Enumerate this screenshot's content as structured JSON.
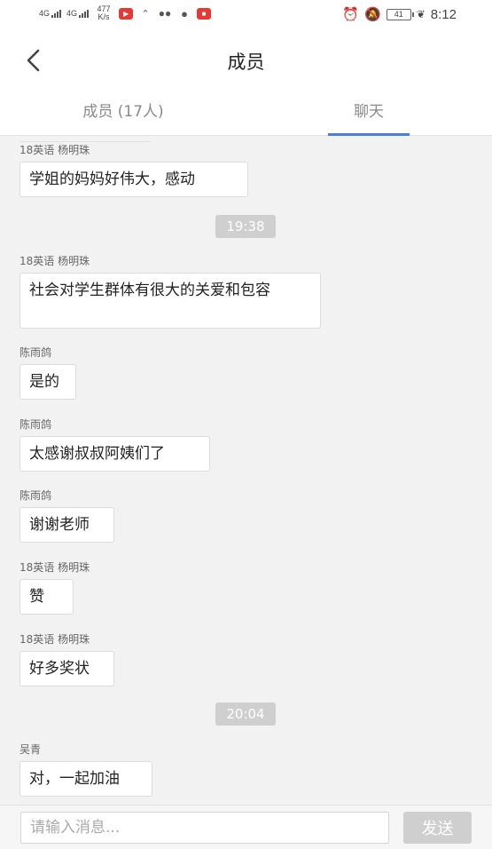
{
  "status_bar": {
    "signal1": "4G",
    "signal2": "4G",
    "speed_value": "477",
    "speed_unit": "K/s",
    "battery": "41",
    "time": "8:12",
    "icons": [
      "alarm-icon",
      "mute-icon",
      "battery-icon",
      "leaf-icon"
    ]
  },
  "header": {
    "title": "成员",
    "back_icon": "chevron-left-icon"
  },
  "tabs": [
    {
      "label": "成员 (17人)",
      "active": false
    },
    {
      "label": "聊天",
      "active": true
    }
  ],
  "accent_color": "#4c7fd6",
  "messages": [
    {
      "sender": "18英语 杨明珠",
      "text": "学姐的妈妈好伟大，感动"
    },
    {
      "time": "19:38"
    },
    {
      "sender": "18英语 杨明珠",
      "text": "社会对学生群体有很大的关爱和包容"
    },
    {
      "sender": "陈雨鸽",
      "text": "是的"
    },
    {
      "sender": "陈雨鸽",
      "text": "太感谢叔叔阿姨们了"
    },
    {
      "sender": "陈雨鸽",
      "text": "谢谢老师"
    },
    {
      "sender": "18英语 杨明珠",
      "text": "赞"
    },
    {
      "sender": "18英语 杨明珠",
      "text": "好多奖状"
    },
    {
      "time": "20:04"
    },
    {
      "sender": "吴青",
      "text": "对，一起加油"
    }
  ],
  "input": {
    "placeholder": "请输入消息...",
    "value": "",
    "send_label": "发送"
  }
}
